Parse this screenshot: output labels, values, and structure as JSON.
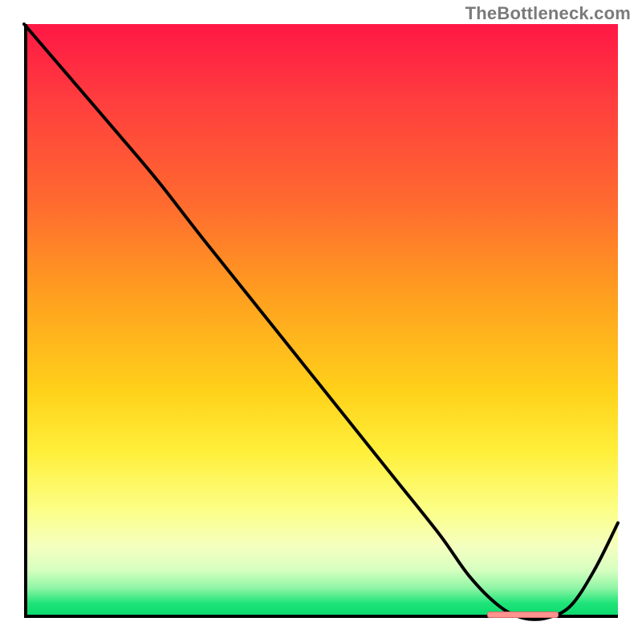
{
  "attribution": "TheBottleneck.com",
  "colors": {
    "top": "#ff1745",
    "mid": "#ffd21a",
    "bottom": "#06d86a",
    "curve": "#000000",
    "axis": "#000000",
    "marker": "#ff938f"
  },
  "chart_data": {
    "type": "line",
    "title": "",
    "xlabel": "",
    "ylabel": "",
    "xlim": [
      0,
      100
    ],
    "ylim": [
      0,
      100
    ],
    "series": [
      {
        "name": "bottleneck-curve",
        "x": [
          0,
          6,
          12,
          18,
          23,
          30,
          38,
          46,
          54,
          62,
          70,
          75,
          80,
          84,
          88,
          92,
          96,
          100
        ],
        "y": [
          100,
          93,
          86,
          79,
          73,
          64,
          54,
          44,
          34,
          24,
          14,
          7,
          2,
          0,
          0,
          2,
          8,
          16
        ]
      }
    ],
    "annotations": [
      {
        "name": "optimal-range-marker",
        "x_start": 78,
        "x_end": 90,
        "y": 0
      }
    ]
  }
}
